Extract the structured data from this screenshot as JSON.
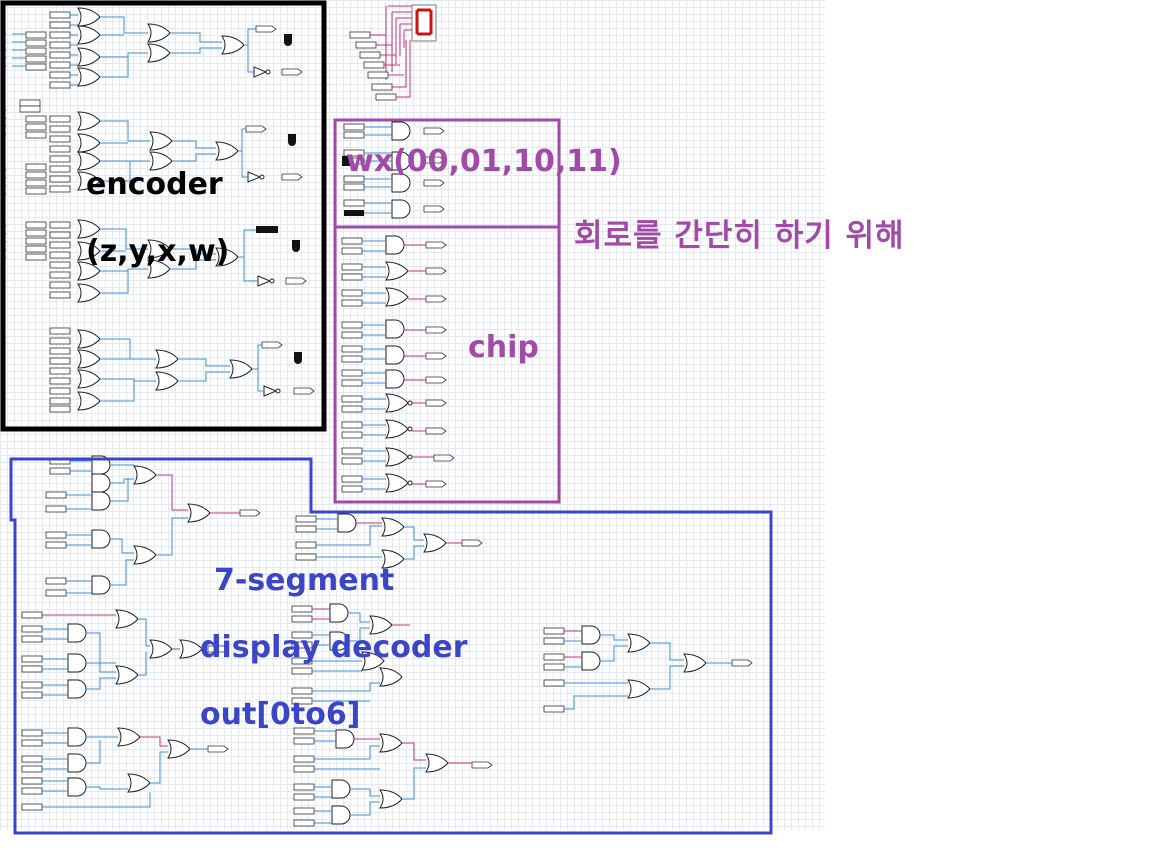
{
  "labels": {
    "encoder_title": "encoder",
    "encoder_vars": "(z,y,x,w)",
    "wx_title": "wx(00,01,10,11)",
    "korean_note": "회로를 간단히 하기 위해",
    "chip_title": "chip",
    "decoder_line1": "7-segment",
    "decoder_line2": "display decoder",
    "decoder_line3": "out[0to6]"
  },
  "colors": {
    "encoder_box": "#000000",
    "chip_box": "#a24aa8",
    "decoder_box": "#3c45c6",
    "wire_blue": "#3c8fd6",
    "wire_pink": "#c4357a",
    "segment_red": "#cc1111"
  }
}
